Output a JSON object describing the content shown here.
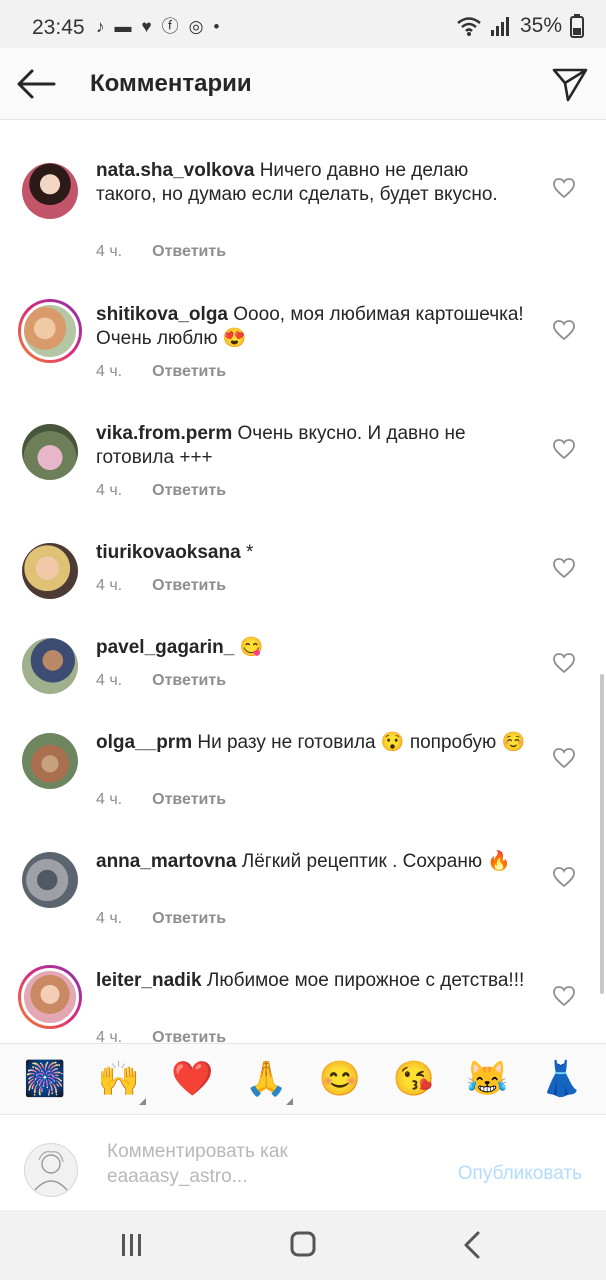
{
  "status_bar": {
    "time": "23:45",
    "battery": "35%",
    "icons": [
      "tiktok-icon",
      "message-icon",
      "heart-icon",
      "facebook-icon",
      "instagram-icon",
      "dot-icon",
      "wifi-icon",
      "signal-icon",
      "battery-icon"
    ]
  },
  "header": {
    "title": "Комментарии",
    "back_icon": "arrow-left-icon",
    "send_icon": "paper-plane-icon"
  },
  "comments": [
    {
      "username": "nata.sha_volkova",
      "text": "Ничего давно не делаю такого, но думаю если сделать, будет вкусно.",
      "time": "4 ч.",
      "reply": "Ответить",
      "story": false,
      "avatar_color": "#b5646c"
    },
    {
      "username": "shitikova_olga",
      "text": "Оооо, моя любимая картошечка! Очень люблю 😍",
      "time": "4 ч.",
      "reply": "Ответить",
      "story": true,
      "avatar_color": "#c69a74"
    },
    {
      "username": "vika.from.perm",
      "text": "Очень вкусно. И давно не готовила +++",
      "time": "4 ч.",
      "reply": "Ответить",
      "story": false,
      "avatar_color": "#9a8aa0"
    },
    {
      "username": "tiurikovaoksana",
      "text": "*",
      "time": "4 ч.",
      "reply": "Ответить",
      "story": false,
      "avatar_color": "#c8a57f"
    },
    {
      "username": "pavel_gagarin_",
      "text": "😋",
      "time": "4 ч.",
      "reply": "Ответить",
      "story": false,
      "avatar_color": "#6f8a64"
    },
    {
      "username": "olga__prm",
      "text": "Ни разу не готовила 😯 попробую ☺️",
      "time": "4 ч.",
      "reply": "Ответить",
      "story": false,
      "avatar_color": "#8a8a62"
    },
    {
      "username": "anna_martovna",
      "text": "Лёгкий рецептик . Сохраню 🔥",
      "time": "4 ч.",
      "reply": "Ответить",
      "story": false,
      "avatar_color": "#7c7d86"
    },
    {
      "username": "leiter_nadik",
      "text": "Любимое мое пирожное с детства!!!",
      "time": "4 ч.",
      "reply": "Ответить",
      "story": true,
      "avatar_color": "#d9a48c"
    }
  ],
  "emoji_bar": {
    "emojis": [
      "🎆",
      "🙌",
      "❤️",
      "🙏",
      "😊",
      "😘",
      "😹",
      "👗"
    ]
  },
  "composer": {
    "placeholder": "Комментировать как eaaaasy_astro...",
    "publish": "Опубликовать"
  },
  "nav_bar": {
    "icons": [
      "recent-apps-icon",
      "home-icon",
      "back-icon"
    ]
  }
}
